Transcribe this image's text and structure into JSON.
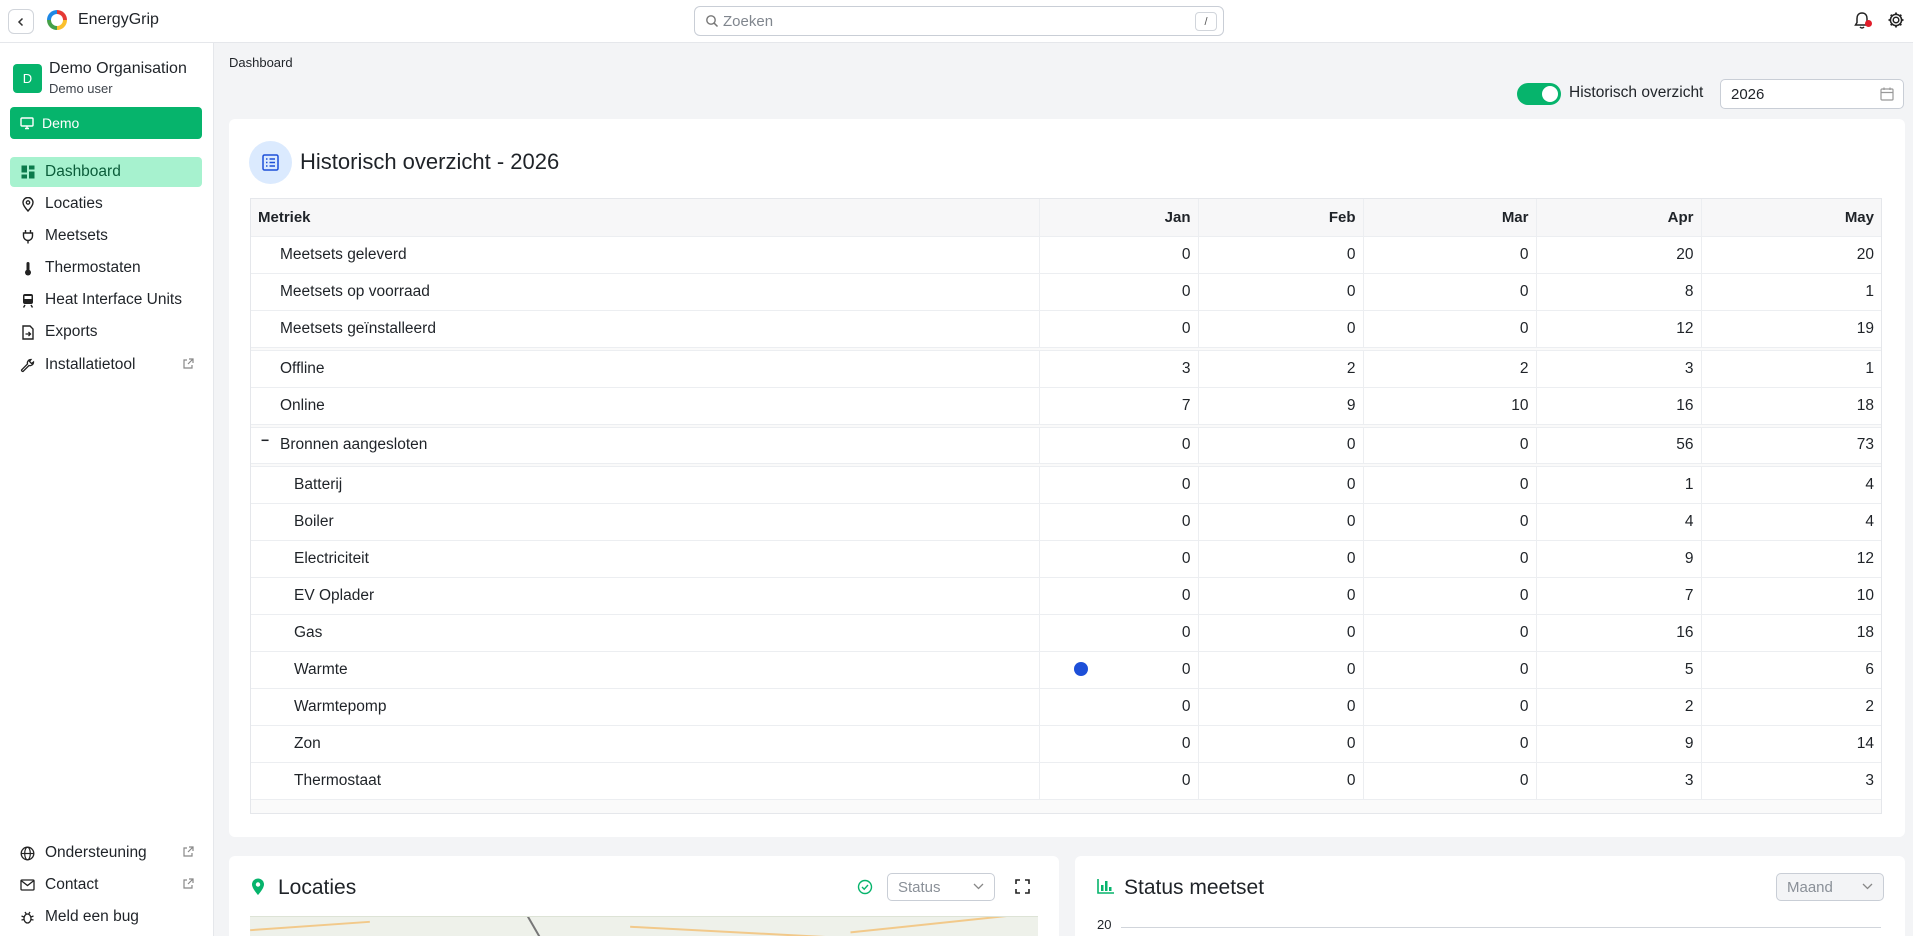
{
  "app": {
    "name": "EnergyGrip"
  },
  "search": {
    "placeholder": "Zoeken",
    "shortcut": "/"
  },
  "org": {
    "avatar_letter": "D",
    "name": "Demo Organisation",
    "user": "Demo user",
    "demo_label": "Demo"
  },
  "sidebar": {
    "items": [
      {
        "label": "Dashboard",
        "icon": "dashboard-icon",
        "active": true
      },
      {
        "label": "Locaties",
        "icon": "map-pin-icon"
      },
      {
        "label": "Meetsets",
        "icon": "plug-icon"
      },
      {
        "label": "Thermostaten",
        "icon": "thermometer-icon"
      },
      {
        "label": "Heat Interface Units",
        "icon": "train-icon"
      },
      {
        "label": "Exports",
        "icon": "file-export-icon"
      },
      {
        "label": "Installatietool",
        "icon": "wrench-icon",
        "external": true
      }
    ],
    "bottom": [
      {
        "label": "Ondersteuning",
        "icon": "globe-icon",
        "external": true
      },
      {
        "label": "Contact",
        "icon": "mail-icon",
        "external": true
      },
      {
        "label": "Meld een bug",
        "icon": "bug-icon"
      }
    ]
  },
  "breadcrumb": "Dashboard",
  "history_toggle": {
    "label": "Historisch overzicht",
    "on": true
  },
  "year": "2026",
  "overview": {
    "title": "Historisch overzicht - 2026",
    "columns": [
      "Metriek",
      "Jan",
      "Feb",
      "Mar",
      "Apr",
      "May"
    ],
    "groups": [
      [
        {
          "label": "Meetsets geleverd",
          "values": [
            "0",
            "0",
            "0",
            "20",
            "20"
          ]
        },
        {
          "label": "Meetsets op voorraad",
          "values": [
            "0",
            "0",
            "0",
            "8",
            "1"
          ]
        },
        {
          "label": "Meetsets geïnstalleerd",
          "values": [
            "0",
            "0",
            "0",
            "12",
            "19"
          ]
        }
      ],
      [
        {
          "label": "Offline",
          "values": [
            "3",
            "2",
            "2",
            "3",
            "1"
          ]
        },
        {
          "label": "Online",
          "values": [
            "7",
            "9",
            "10",
            "16",
            "18"
          ]
        }
      ],
      [
        {
          "label": "Bronnen aangesloten",
          "values": [
            "0",
            "0",
            "0",
            "56",
            "73"
          ],
          "collapsible": true,
          "toggle": "−"
        }
      ],
      [
        {
          "label": "Batterij",
          "values": [
            "0",
            "0",
            "0",
            "1",
            "4"
          ],
          "indent": true
        },
        {
          "label": "Boiler",
          "values": [
            "0",
            "0",
            "0",
            "4",
            "4"
          ],
          "indent": true
        },
        {
          "label": "Electriciteit",
          "values": [
            "0",
            "0",
            "0",
            "9",
            "12"
          ],
          "indent": true
        },
        {
          "label": "EV Oplader",
          "values": [
            "0",
            "0",
            "0",
            "7",
            "10"
          ],
          "indent": true
        },
        {
          "label": "Gas",
          "values": [
            "0",
            "0",
            "0",
            "16",
            "18"
          ],
          "indent": true
        },
        {
          "label": "Warmte",
          "values": [
            "0",
            "0",
            "0",
            "5",
            "6"
          ],
          "indent": true
        },
        {
          "label": "Warmtepomp",
          "values": [
            "0",
            "0",
            "0",
            "2",
            "2"
          ],
          "indent": true
        },
        {
          "label": "Zon",
          "values": [
            "0",
            "0",
            "0",
            "9",
            "14"
          ],
          "indent": true
        },
        {
          "label": "Thermostaat",
          "values": [
            "0",
            "0",
            "0",
            "3",
            "3"
          ],
          "indent": true
        }
      ]
    ]
  },
  "locaties_card": {
    "title": "Locaties",
    "status_placeholder": "Status"
  },
  "status_card": {
    "title": "Status meetset",
    "period_placeholder": "Maand",
    "y_tick": "20"
  },
  "colors": {
    "accent": "#06b46c",
    "active_nav_bg": "#a7f2cf",
    "icon_blue": "#1d4fd8"
  }
}
